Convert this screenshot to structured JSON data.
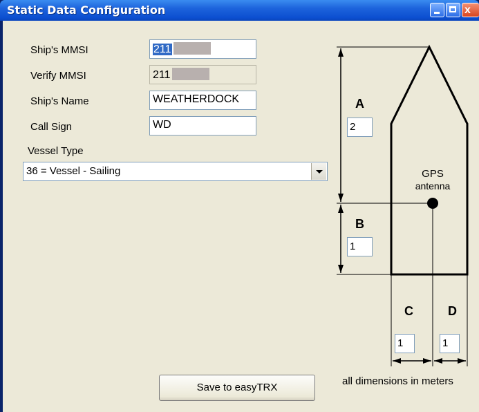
{
  "window": {
    "title": "Static Data Configuration",
    "close_glyph": "x"
  },
  "form": {
    "mmsi_label": "Ship's MMSI",
    "mmsi_value": "211",
    "verify_label": "Verify MMSI",
    "verify_value": "211",
    "name_label": "Ship's Name",
    "name_value": "WEATHERDOCK",
    "callsign_label": "Call Sign",
    "callsign_value": "WD",
    "vessel_type_label": "Vessel Type",
    "vessel_type_value": "36 = Vessel - Sailing"
  },
  "diagram": {
    "a_label": "A",
    "a_value": "2",
    "b_label": "B",
    "b_value": "1",
    "c_label": "C",
    "c_value": "1",
    "d_label": "D",
    "d_value": "1",
    "gps_line1": "GPS",
    "gps_line2": "antenna",
    "units_note": "all dimensions in meters"
  },
  "actions": {
    "save_label": "Save to easyTRX"
  },
  "colors": {
    "titlebar": "#0c4fd0",
    "client_bg": "#ece9d8",
    "selection": "#316ac5"
  }
}
